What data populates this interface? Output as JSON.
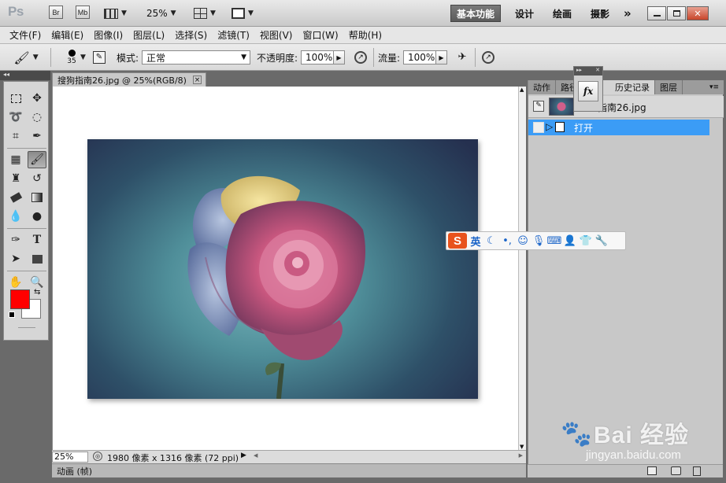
{
  "app": {
    "logo": "Ps",
    "bridge": "Br",
    "minibridge": "Mb",
    "zoom": "25%",
    "workspaces": [
      "基本功能",
      "设计",
      "绘画",
      "摄影"
    ],
    "more": "»"
  },
  "window_buttons": [
    "minimize-icon",
    "restore-icon",
    "close-icon"
  ],
  "menu": [
    "文件(F)",
    "编辑(E)",
    "图像(I)",
    "图层(L)",
    "选择(S)",
    "滤镜(T)",
    "视图(V)",
    "窗口(W)",
    "帮助(H)"
  ],
  "options": {
    "brush_size": "35",
    "mode_label": "模式:",
    "mode_value": "正常",
    "opacity_label": "不透明度:",
    "opacity_value": "100%",
    "flow_label": "流量:",
    "flow_value": "100%"
  },
  "document": {
    "tab_title": "搜狗指南26.jpg @ 25%(RGB/8)",
    "close": "×",
    "zoom": "25%",
    "info": "1980 像素 x 1316 像素 (72 ppi)"
  },
  "bottom_panel": {
    "label": "动画 (帧)"
  },
  "panels": {
    "tabs": [
      "动作",
      "路径",
      "历史记录",
      "图层"
    ],
    "active_tab": "历史记录",
    "history_snapshot": "指南26.jpg",
    "history_items": [
      "打开"
    ]
  },
  "float_panel": {
    "fx": "fx"
  },
  "ime": {
    "logo": "S",
    "lang": "英",
    "icons": [
      "moon-icon",
      "punctuation-icon",
      "smile-icon",
      "microphone-icon",
      "keyboard-icon",
      "user-tools-icon",
      "shirt-icon",
      "wrench-icon"
    ]
  },
  "watermark": {
    "brand": "Bai 经验",
    "url": "jingyan.baidu.com"
  },
  "colors": {
    "foreground": "#ff0000",
    "background": "#ffffff",
    "history_highlight": "#3b9cf6",
    "ime_logo": "#e8531d"
  }
}
